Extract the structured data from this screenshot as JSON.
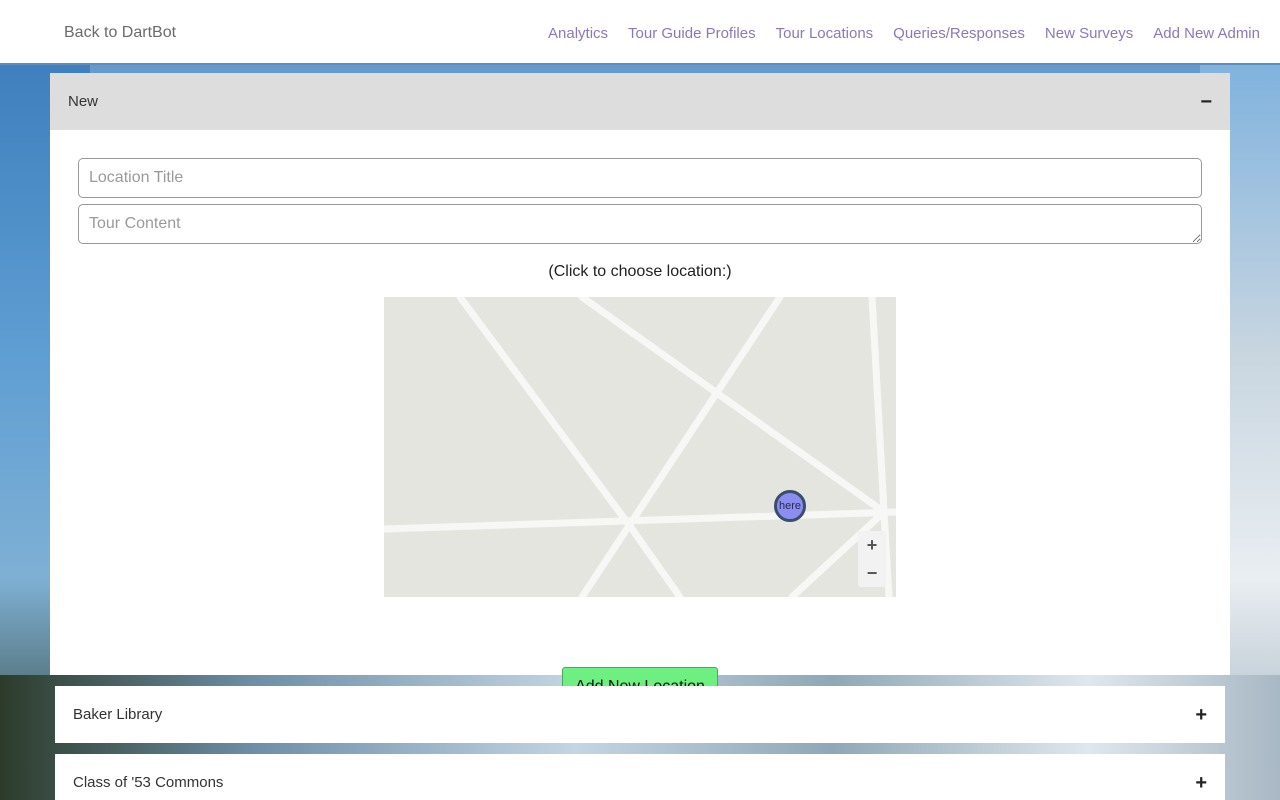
{
  "navbar": {
    "brand": "Back to DartBot",
    "links": [
      {
        "label": "Analytics"
      },
      {
        "label": "Tour Guide Profiles"
      },
      {
        "label": "Tour Locations"
      },
      {
        "label": "Queries/Responses"
      },
      {
        "label": "New Surveys"
      },
      {
        "label": "Add New Admin"
      }
    ]
  },
  "new_panel": {
    "title": "New",
    "toggle_symbol": "−",
    "location_title_placeholder": "Location Title",
    "tour_content_placeholder": "Tour Content",
    "map_caption": "(Click to choose location:)",
    "marker_label": "here",
    "zoom_in": "+",
    "zoom_out": "−",
    "submit_label": "Add New Location"
  },
  "locations": [
    {
      "title": "Baker Library",
      "toggle_symbol": "+"
    },
    {
      "title": "Class of '53 Commons",
      "toggle_symbol": "+"
    }
  ],
  "colors": {
    "nav_link": "#8a79b5",
    "submit_button": "#6ef080",
    "marker_fill": "#8b8ef0",
    "map_background": "#e5e5e0"
  }
}
